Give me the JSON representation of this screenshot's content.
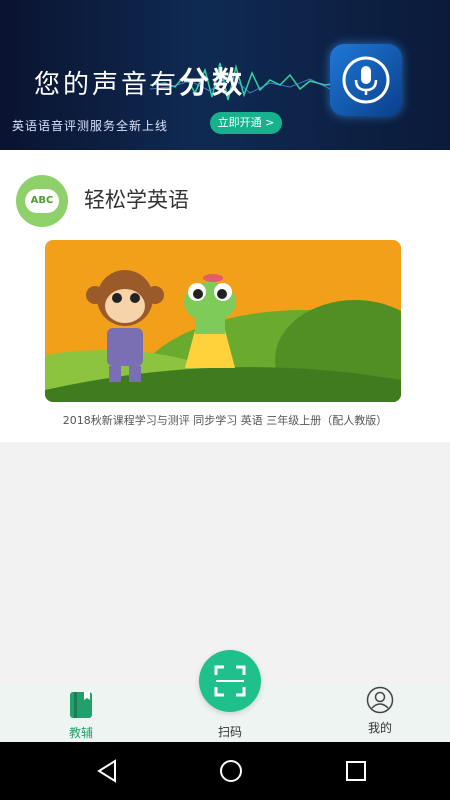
{
  "banner": {
    "title_prefix": "您的声音有",
    "title_highlight": "分数",
    "subtitle": "英语语音评测服务全新上线",
    "button_label": "立即开通 >",
    "icon": "microphone-icon"
  },
  "section": {
    "title": "轻松学英语",
    "badge_text": "ABC",
    "icon": "abc-speech-bubble-icon"
  },
  "book": {
    "caption": "2018秋新课程学习与测评 同步学习 英语 三年级上册（配人教版）"
  },
  "bottom_nav": {
    "items": [
      {
        "label": "教辅",
        "icon": "book-icon",
        "active": true
      },
      {
        "label": "扫码",
        "icon": "scan-icon",
        "active": false
      },
      {
        "label": "我的",
        "icon": "user-icon",
        "active": false
      }
    ]
  },
  "colors": {
    "accent": "#20c08c",
    "banner_bg": "#0f2a52",
    "active_tab": "#22a06b"
  },
  "system_nav": [
    "back-icon",
    "home-icon",
    "recents-icon"
  ]
}
